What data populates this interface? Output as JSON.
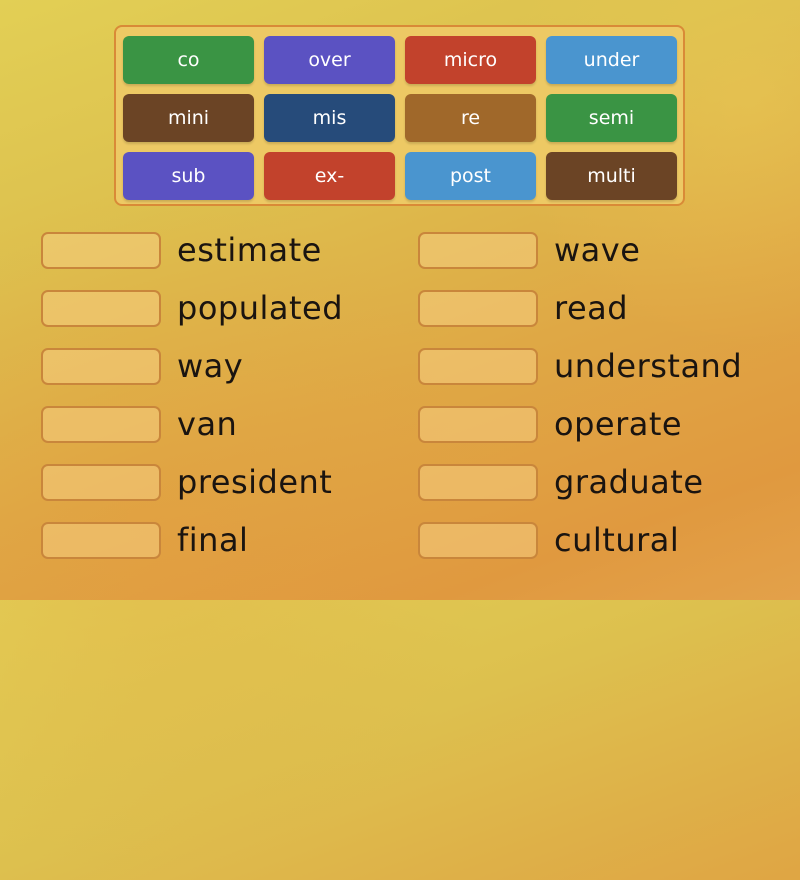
{
  "prefix_bank": {
    "tiles": [
      {
        "label": "co",
        "color": "#3a9444"
      },
      {
        "label": "over",
        "color": "#5b52c2"
      },
      {
        "label": "micro",
        "color": "#c2422c"
      },
      {
        "label": "under",
        "color": "#4a95cf"
      },
      {
        "label": "mini",
        "color": "#6b4425"
      },
      {
        "label": "mis",
        "color": "#264b7a"
      },
      {
        "label": "re",
        "color": "#a0682a"
      },
      {
        "label": "semi",
        "color": "#3a9444"
      },
      {
        "label": "sub",
        "color": "#5b52c2"
      },
      {
        "label": "ex-",
        "color": "#c2422c"
      },
      {
        "label": "post",
        "color": "#4a95cf"
      },
      {
        "label": "multi",
        "color": "#6b4425"
      }
    ]
  },
  "targets": {
    "left": [
      {
        "word": "estimate",
        "answer": ""
      },
      {
        "word": "populated",
        "answer": ""
      },
      {
        "word": "way",
        "answer": ""
      },
      {
        "word": "van",
        "answer": ""
      },
      {
        "word": "president",
        "answer": ""
      },
      {
        "word": "final",
        "answer": ""
      }
    ],
    "right": [
      {
        "word": "wave",
        "answer": ""
      },
      {
        "word": "read",
        "answer": ""
      },
      {
        "word": "understand",
        "answer": ""
      },
      {
        "word": "operate",
        "answer": ""
      },
      {
        "word": "graduate",
        "answer": ""
      },
      {
        "word": "cultural",
        "answer": ""
      }
    ]
  }
}
